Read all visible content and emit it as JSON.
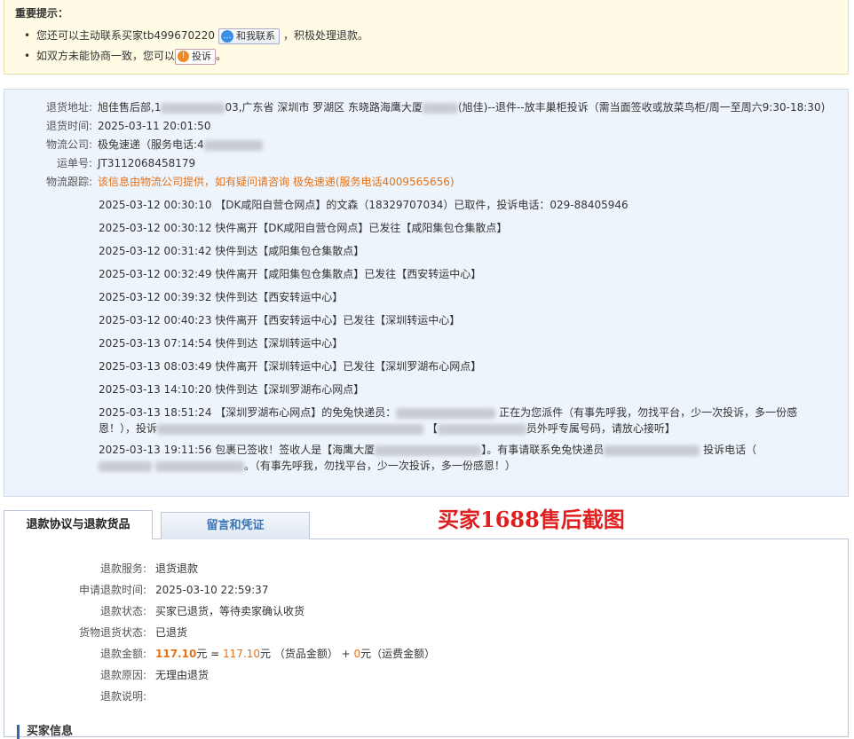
{
  "notice": {
    "title": "重要提示：",
    "line1_before": "您还可以主动联系买家tb499670220",
    "contact_button": "和我联系",
    "line1_after": "，积极处理退款。",
    "line2_before": "如双方未能协商一致，您可以",
    "complain_button": "投诉",
    "line2_after": "。"
  },
  "logistics": {
    "labels": {
      "address": "退货地址:",
      "time": "退货时间:",
      "company": "物流公司:",
      "tracking": "运单号:",
      "trace": "物流跟踪:"
    },
    "address_prefix": "旭佳售后部,1",
    "address_mid": "03,广东省 深圳市 罗湖区 东晓路海鹰大厦",
    "address_suffix": "(旭佳)--退件--放丰巢柜投诉（需当面签收或放菜鸟柜/周一至周六9:30-18:30)",
    "time": "2025-03-11 20:01:50",
    "company": "极兔速递（服务电话:4",
    "tracking": "JT3112068458179",
    "trace_note": "该信息由物流公司提供，如有疑问请咨询 极兔速递(服务电话4009565656)",
    "traces": [
      "2025-03-12 00:30:10 【DK咸阳自营仓网点】的文森（18329707034）已取件，投诉电话：029-88405946",
      "2025-03-12 00:30:12 快件离开【DK咸阳自营仓网点】已发往【咸阳集包仓集散点】",
      "2025-03-12 00:31:42 快件到达【咸阳集包仓集散点】",
      "2025-03-12 00:32:49 快件离开【咸阳集包仓集散点】已发往【西安转运中心】",
      "2025-03-12 00:39:32 快件到达【西安转运中心】",
      "2025-03-12 00:40:23 快件离开【西安转运中心】已发往【深圳转运中心】",
      "2025-03-13 07:14:54 快件到达【深圳转运中心】",
      "2025-03-13 08:03:49 快件离开【深圳转运中心】已发往【深圳罗湖布心网点】",
      "2025-03-13 14:10:20 快件到达【深圳罗湖布心网点】"
    ],
    "trace_10_a": "2025-03-13 18:51:24 【深圳罗湖布心网点】的免兔快递员：",
    "trace_10_b": "正在为您派件（有事先呼我，勿找平台，少一次投诉，多一份感恩！），投诉",
    "trace_10_c": "【",
    "trace_10_d": "员外呼专属号码，请放心接听】",
    "trace_11_a": "2025-03-13 19:11:56 包裹已签收！签收人是【海鹰大厦",
    "trace_11_b": "】。有事请联系免兔快递员",
    "trace_11_c": "投诉电话（",
    "trace_11_d": "。（有事先呼我，勿找平台，少一次投诉，多一份感恩！）"
  },
  "tabs": {
    "active": "退款协议与退款货品",
    "inactive": "留言和凭证"
  },
  "annotation": "买家1688售后截图",
  "refund": {
    "service_label": "退款服务:",
    "service": "退货退款",
    "apply_time_label": "申请退款时间:",
    "apply_time": "2025-03-10 22:59:37",
    "status_label": "退款状态:",
    "status": "买家已退货，等待卖家确认收货",
    "goods_status_label": "货物退货状态:",
    "goods_status": "已退货",
    "amount_label": "退款金额:",
    "amount": "117.10",
    "amount_unit1": "元 = ",
    "goods_amount": "117.10",
    "amount_unit2": "元 （货品金额） + ",
    "shipping_amount": "0",
    "amount_unit3": "元（运费金额）",
    "reason_label": "退款原因:",
    "reason": "无理由退货",
    "explain_label": "退款说明:",
    "explain": ""
  },
  "buyer_section_title": "买家信息"
}
